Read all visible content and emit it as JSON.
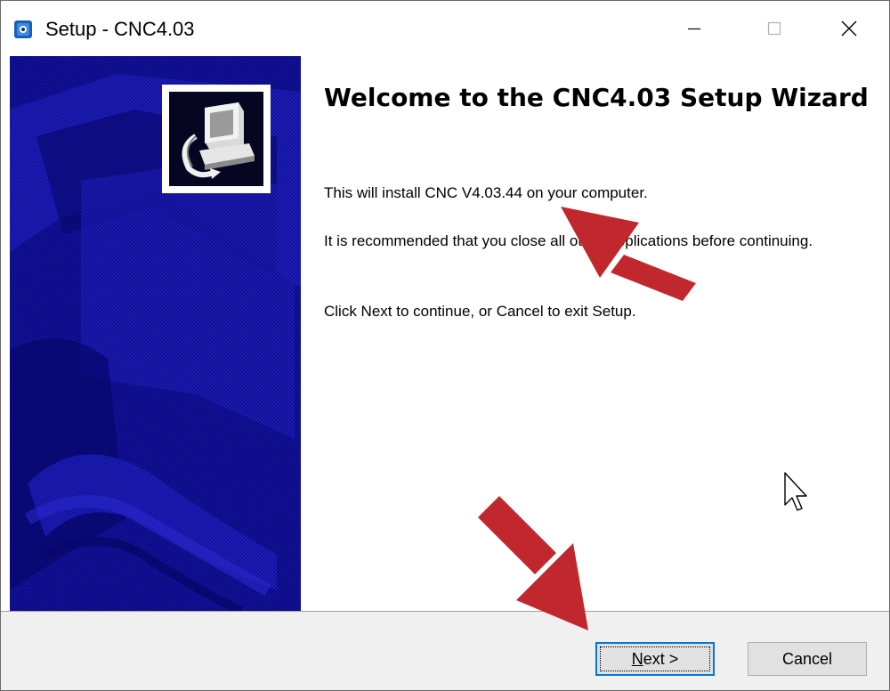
{
  "window": {
    "title": "Setup - CNC4.03",
    "controls": {
      "minimize": "minimize",
      "maximize": "maximize",
      "close": "close"
    }
  },
  "content": {
    "heading": "Welcome to the CNC4.03 Setup Wizard",
    "paragraphs": [
      "This will install CNC V4.03.44 on your computer.",
      "It is recommended that you close all other applications before continuing.",
      "Click Next to continue, or Cancel to exit Setup."
    ]
  },
  "buttons": {
    "next_mnemonic": "N",
    "next_rest": "ext >",
    "cancel": "Cancel"
  },
  "colors": {
    "sidepanel": "#0a0a7a",
    "annotation_arrow": "#c0282d",
    "focus_border": "#0078d7"
  },
  "icons": [
    "setup-app-icon",
    "installer-computer-icon",
    "mouse-cursor-icon",
    "annotation-arrow"
  ]
}
